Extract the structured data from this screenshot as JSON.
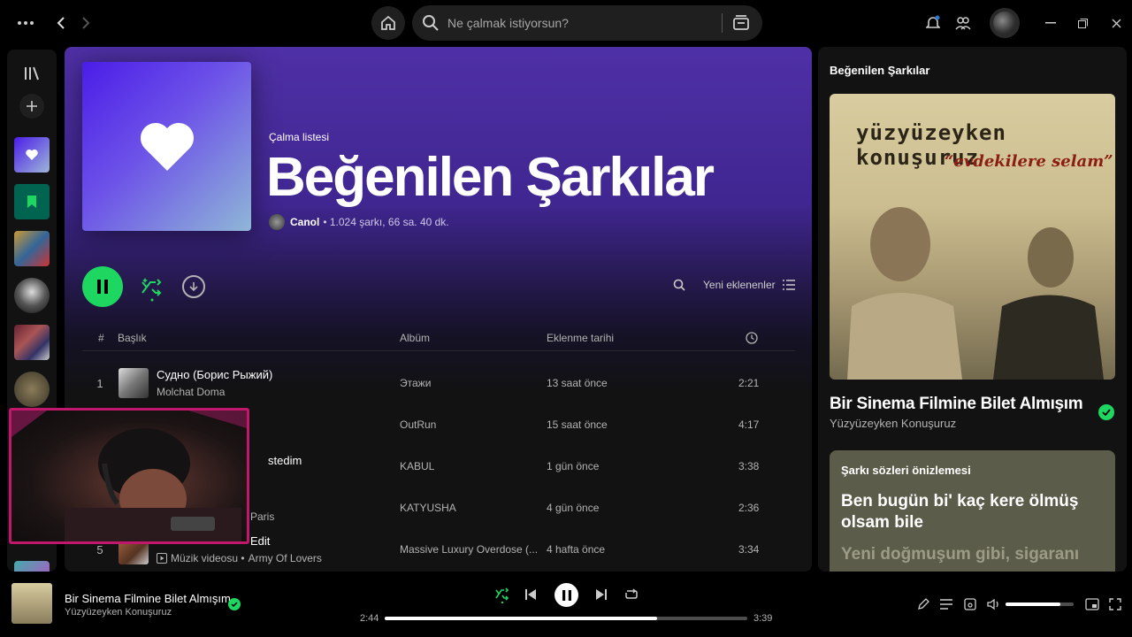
{
  "topbar": {
    "search_placeholder": "Ne çalmak istiyorsun?",
    "icons": [
      "more-icon",
      "back-icon",
      "forward-icon",
      "home-icon",
      "search-icon",
      "browse-icon",
      "bell-icon",
      "friends-icon",
      "minimize-icon",
      "restore-icon",
      "close-icon"
    ]
  },
  "playlist": {
    "type_label": "Çalma listesi",
    "title": "Beğenilen Şarkılar",
    "owner": "Canol",
    "stats": "• 1.024 şarkı, 66 sa. 40 dk.",
    "sort_label": "Yeni eklenenler"
  },
  "table": {
    "headers": {
      "num": "#",
      "title": "Başlık",
      "album": "Albüm",
      "added": "Eklenme tarihi"
    },
    "rows": [
      {
        "num": "1",
        "title": "Судно (Борис Рыжий)",
        "artist": "Molchat Doma",
        "album": "Этажи",
        "added": "13 saat önce",
        "duration": "2:21",
        "video_label": ""
      },
      {
        "num": "",
        "title": "",
        "artist": "",
        "album": "OutRun",
        "added": "15 saat önce",
        "duration": "4:17",
        "video_label": ""
      },
      {
        "num": "",
        "title": "stedim",
        "artist": "",
        "album": "KABUL",
        "added": "1 gün önce",
        "duration": "3:38",
        "video_label": ""
      },
      {
        "num": "",
        "title": "",
        "artist": "Paris",
        "album": "KATYUSHA",
        "added": "4 gün önce",
        "duration": "2:36",
        "video_label": ""
      },
      {
        "num": "5",
        "title": "Edit",
        "artist": "Army Of Lovers",
        "album": "Massive Luxury Overdose (...",
        "added": "4 hafta önce",
        "duration": "3:34",
        "video_label": "Müzik videosu •"
      }
    ]
  },
  "right_panel": {
    "title": "Beğenilen Şarkılar",
    "album_text_1": "yüzyüzeyken konuşuruz",
    "album_text_2": "“evdekilere selam”",
    "song": "Bir Sinema Filmine Bilet Almışım",
    "artist": "Yüzyüzeyken Konuşuruz",
    "lyrics_header": "Şarkı sözleri önizlemesi",
    "lyrics_line_1": "Ben bugün bi' kaç kere ölmüş olsam bile",
    "lyrics_line_2": "Yeni doğmuşum gibi, sigaranı"
  },
  "player": {
    "title": "Bir Sinema Filmine Bilet Almışım",
    "artist": "Yüzyüzeyken Konuşuruz",
    "elapsed": "2:44",
    "total": "3:39",
    "progress_fraction": 0.75,
    "volume_fraction": 0.8
  },
  "colors": {
    "accent": "#1ed760",
    "playlist_gradient": "#4f30a6",
    "background": "#121212"
  }
}
